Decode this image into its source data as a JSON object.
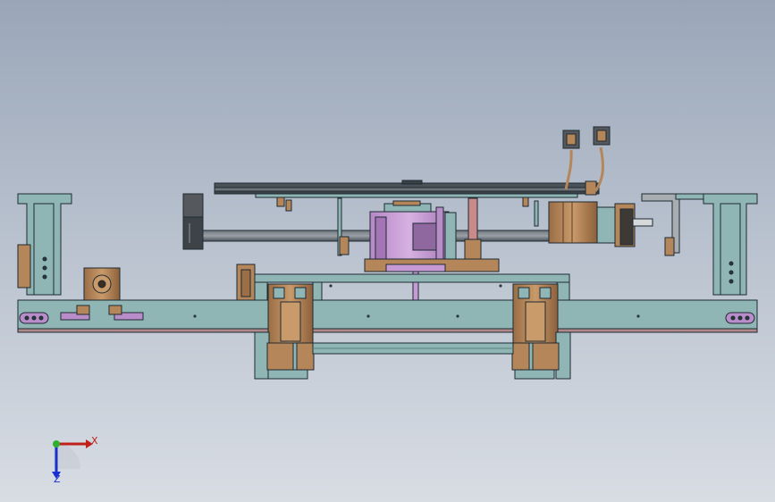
{
  "triad": {
    "x_label": "X",
    "z_label": "Z"
  },
  "colors": {
    "teal_frame": "#8fb6b4",
    "copper": "#b5865a",
    "violet_slider": "#c79ad6",
    "dark_steel": "#55595e",
    "outline": "#1e2a33"
  }
}
